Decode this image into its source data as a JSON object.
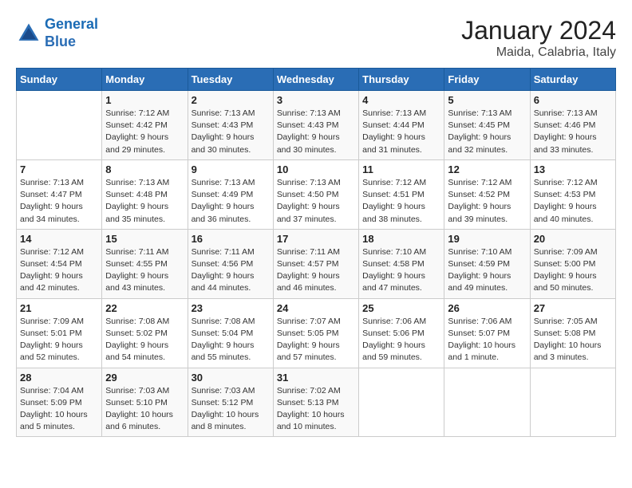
{
  "logo": {
    "text_general": "General",
    "text_blue": "Blue"
  },
  "header": {
    "month": "January 2024",
    "location": "Maida, Calabria, Italy"
  },
  "weekdays": [
    "Sunday",
    "Monday",
    "Tuesday",
    "Wednesday",
    "Thursday",
    "Friday",
    "Saturday"
  ],
  "weeks": [
    [
      {
        "day": "",
        "sunrise": "",
        "sunset": "",
        "daylight": ""
      },
      {
        "day": "1",
        "sunrise": "Sunrise: 7:12 AM",
        "sunset": "Sunset: 4:42 PM",
        "daylight": "Daylight: 9 hours and 29 minutes."
      },
      {
        "day": "2",
        "sunrise": "Sunrise: 7:13 AM",
        "sunset": "Sunset: 4:43 PM",
        "daylight": "Daylight: 9 hours and 30 minutes."
      },
      {
        "day": "3",
        "sunrise": "Sunrise: 7:13 AM",
        "sunset": "Sunset: 4:43 PM",
        "daylight": "Daylight: 9 hours and 30 minutes."
      },
      {
        "day": "4",
        "sunrise": "Sunrise: 7:13 AM",
        "sunset": "Sunset: 4:44 PM",
        "daylight": "Daylight: 9 hours and 31 minutes."
      },
      {
        "day": "5",
        "sunrise": "Sunrise: 7:13 AM",
        "sunset": "Sunset: 4:45 PM",
        "daylight": "Daylight: 9 hours and 32 minutes."
      },
      {
        "day": "6",
        "sunrise": "Sunrise: 7:13 AM",
        "sunset": "Sunset: 4:46 PM",
        "daylight": "Daylight: 9 hours and 33 minutes."
      }
    ],
    [
      {
        "day": "7",
        "sunrise": "Sunrise: 7:13 AM",
        "sunset": "Sunset: 4:47 PM",
        "daylight": "Daylight: 9 hours and 34 minutes."
      },
      {
        "day": "8",
        "sunrise": "Sunrise: 7:13 AM",
        "sunset": "Sunset: 4:48 PM",
        "daylight": "Daylight: 9 hours and 35 minutes."
      },
      {
        "day": "9",
        "sunrise": "Sunrise: 7:13 AM",
        "sunset": "Sunset: 4:49 PM",
        "daylight": "Daylight: 9 hours and 36 minutes."
      },
      {
        "day": "10",
        "sunrise": "Sunrise: 7:13 AM",
        "sunset": "Sunset: 4:50 PM",
        "daylight": "Daylight: 9 hours and 37 minutes."
      },
      {
        "day": "11",
        "sunrise": "Sunrise: 7:12 AM",
        "sunset": "Sunset: 4:51 PM",
        "daylight": "Daylight: 9 hours and 38 minutes."
      },
      {
        "day": "12",
        "sunrise": "Sunrise: 7:12 AM",
        "sunset": "Sunset: 4:52 PM",
        "daylight": "Daylight: 9 hours and 39 minutes."
      },
      {
        "day": "13",
        "sunrise": "Sunrise: 7:12 AM",
        "sunset": "Sunset: 4:53 PM",
        "daylight": "Daylight: 9 hours and 40 minutes."
      }
    ],
    [
      {
        "day": "14",
        "sunrise": "Sunrise: 7:12 AM",
        "sunset": "Sunset: 4:54 PM",
        "daylight": "Daylight: 9 hours and 42 minutes."
      },
      {
        "day": "15",
        "sunrise": "Sunrise: 7:11 AM",
        "sunset": "Sunset: 4:55 PM",
        "daylight": "Daylight: 9 hours and 43 minutes."
      },
      {
        "day": "16",
        "sunrise": "Sunrise: 7:11 AM",
        "sunset": "Sunset: 4:56 PM",
        "daylight": "Daylight: 9 hours and 44 minutes."
      },
      {
        "day": "17",
        "sunrise": "Sunrise: 7:11 AM",
        "sunset": "Sunset: 4:57 PM",
        "daylight": "Daylight: 9 hours and 46 minutes."
      },
      {
        "day": "18",
        "sunrise": "Sunrise: 7:10 AM",
        "sunset": "Sunset: 4:58 PM",
        "daylight": "Daylight: 9 hours and 47 minutes."
      },
      {
        "day": "19",
        "sunrise": "Sunrise: 7:10 AM",
        "sunset": "Sunset: 4:59 PM",
        "daylight": "Daylight: 9 hours and 49 minutes."
      },
      {
        "day": "20",
        "sunrise": "Sunrise: 7:09 AM",
        "sunset": "Sunset: 5:00 PM",
        "daylight": "Daylight: 9 hours and 50 minutes."
      }
    ],
    [
      {
        "day": "21",
        "sunrise": "Sunrise: 7:09 AM",
        "sunset": "Sunset: 5:01 PM",
        "daylight": "Daylight: 9 hours and 52 minutes."
      },
      {
        "day": "22",
        "sunrise": "Sunrise: 7:08 AM",
        "sunset": "Sunset: 5:02 PM",
        "daylight": "Daylight: 9 hours and 54 minutes."
      },
      {
        "day": "23",
        "sunrise": "Sunrise: 7:08 AM",
        "sunset": "Sunset: 5:04 PM",
        "daylight": "Daylight: 9 hours and 55 minutes."
      },
      {
        "day": "24",
        "sunrise": "Sunrise: 7:07 AM",
        "sunset": "Sunset: 5:05 PM",
        "daylight": "Daylight: 9 hours and 57 minutes."
      },
      {
        "day": "25",
        "sunrise": "Sunrise: 7:06 AM",
        "sunset": "Sunset: 5:06 PM",
        "daylight": "Daylight: 9 hours and 59 minutes."
      },
      {
        "day": "26",
        "sunrise": "Sunrise: 7:06 AM",
        "sunset": "Sunset: 5:07 PM",
        "daylight": "Daylight: 10 hours and 1 minute."
      },
      {
        "day": "27",
        "sunrise": "Sunrise: 7:05 AM",
        "sunset": "Sunset: 5:08 PM",
        "daylight": "Daylight: 10 hours and 3 minutes."
      }
    ],
    [
      {
        "day": "28",
        "sunrise": "Sunrise: 7:04 AM",
        "sunset": "Sunset: 5:09 PM",
        "daylight": "Daylight: 10 hours and 5 minutes."
      },
      {
        "day": "29",
        "sunrise": "Sunrise: 7:03 AM",
        "sunset": "Sunset: 5:10 PM",
        "daylight": "Daylight: 10 hours and 6 minutes."
      },
      {
        "day": "30",
        "sunrise": "Sunrise: 7:03 AM",
        "sunset": "Sunset: 5:12 PM",
        "daylight": "Daylight: 10 hours and 8 minutes."
      },
      {
        "day": "31",
        "sunrise": "Sunrise: 7:02 AM",
        "sunset": "Sunset: 5:13 PM",
        "daylight": "Daylight: 10 hours and 10 minutes."
      },
      {
        "day": "",
        "sunrise": "",
        "sunset": "",
        "daylight": ""
      },
      {
        "day": "",
        "sunrise": "",
        "sunset": "",
        "daylight": ""
      },
      {
        "day": "",
        "sunrise": "",
        "sunset": "",
        "daylight": ""
      }
    ]
  ]
}
